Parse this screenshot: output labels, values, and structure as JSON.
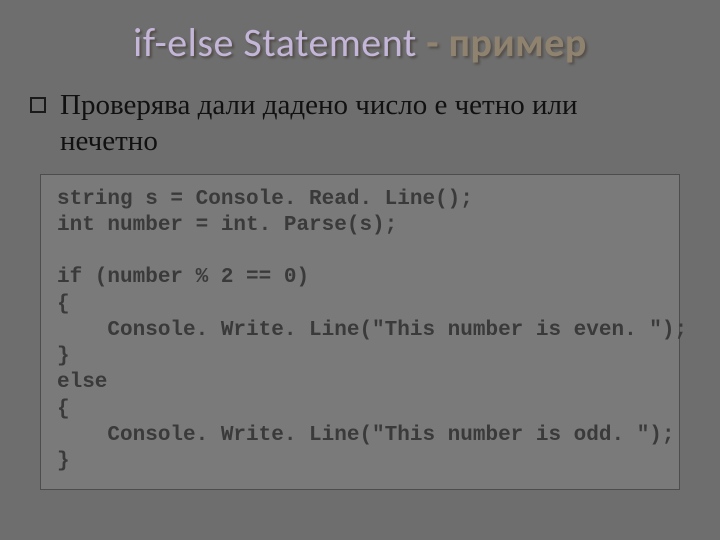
{
  "title": {
    "part_a": "if-else Statement",
    "part_b": " - пример"
  },
  "bullet_text": "Проверява дали дадено число е четно или нечетно",
  "code": {
    "l1": "string s = Console. Read. Line();",
    "l2": "int number = int. Parse(s);",
    "l3": "",
    "l4": "if (number % 2 == 0)",
    "l5": "{",
    "l6": "    Console. Write. Line(\"This number is even. \");",
    "l7": "}",
    "l8": "else",
    "l9": "{",
    "l10": "    Console. Write. Line(\"This number is odd. \");",
    "l11": "}"
  }
}
